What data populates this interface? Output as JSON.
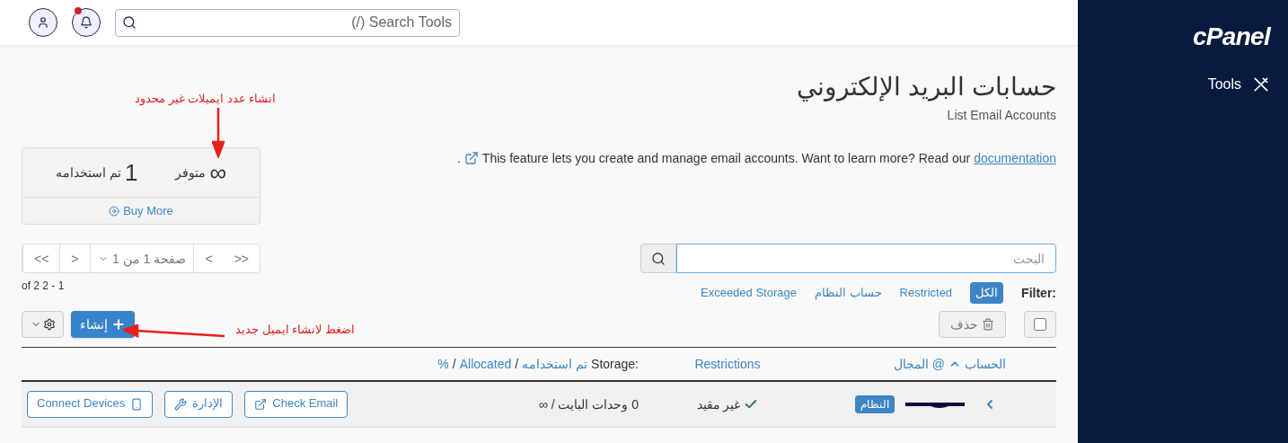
{
  "topbar": {
    "search": {
      "placeholder": "(/) Search Tools"
    },
    "notifications": {
      "unread": true
    }
  },
  "sidebar": {
    "logo": "cPanel",
    "items": [
      {
        "label": "Tools",
        "kind": "tools"
      }
    ]
  },
  "page": {
    "title": "حسابات البريد الإلكتروني",
    "subtitle": "List Email Accounts",
    "description": "This feature lets you create and manage email accounts. Want to learn more? Read our ",
    "description_link": "documentation",
    "description_end": "."
  },
  "stats": {
    "items": [
      {
        "value": "∞",
        "label": "متوفر"
      },
      {
        "value": "1",
        "label": "تم استخدامه"
      }
    ],
    "buy_more": "Buy More"
  },
  "pagination": {
    "buttons": [
      {
        "label": ">>",
        "kind": "nav"
      },
      {
        "label": "<",
        "kind": "nav"
      },
      {
        "label": "صفحة 1 من 1",
        "kind": "select"
      },
      {
        "label": ">",
        "kind": "nav"
      },
      {
        "label": "<<",
        "kind": "nav"
      }
    ],
    "range": "of 2 2 - 1"
  },
  "search": {
    "placeholder": "البحث"
  },
  "filter": {
    "label": "Filter:",
    "options": [
      {
        "label": "الكل",
        "selected": true
      },
      {
        "label": "Restricted",
        "selected": false
      },
      {
        "label": "حساب النظام",
        "selected": false
      },
      {
        "label": "Exceeded Storage",
        "selected": false
      }
    ]
  },
  "toolbar": {
    "create": "إنشاء",
    "delete": {
      "label": "حذف",
      "disabled": true
    },
    "select_all": {
      "checked": false
    }
  },
  "table": {
    "account_header": {
      "first": "الحساب",
      "second": "@ المجال"
    },
    "restrictions_header": "Restrictions",
    "storage_header": {
      "label": "Storage:",
      "parts": [
        "تم استخدامه",
        "Allocated",
        "%"
      ],
      "separator": "/"
    },
    "rows": [
      {
        "badge": "النظام",
        "restrictions": "غير مقيد",
        "storage": "0 وحدات البايت / ∞",
        "actions": [
          {
            "label": "Check Email",
            "kind": "external"
          },
          {
            "label": "الإدارة",
            "kind": "wrench"
          },
          {
            "label": "Connect Devices",
            "kind": "phone"
          }
        ]
      }
    ]
  },
  "annotations": [
    {
      "text": "انشاء عدد ايميلات غير محدود",
      "kind": "down"
    },
    {
      "text": "اضغط لانشاء ايميل جديد",
      "kind": "left"
    }
  ]
}
